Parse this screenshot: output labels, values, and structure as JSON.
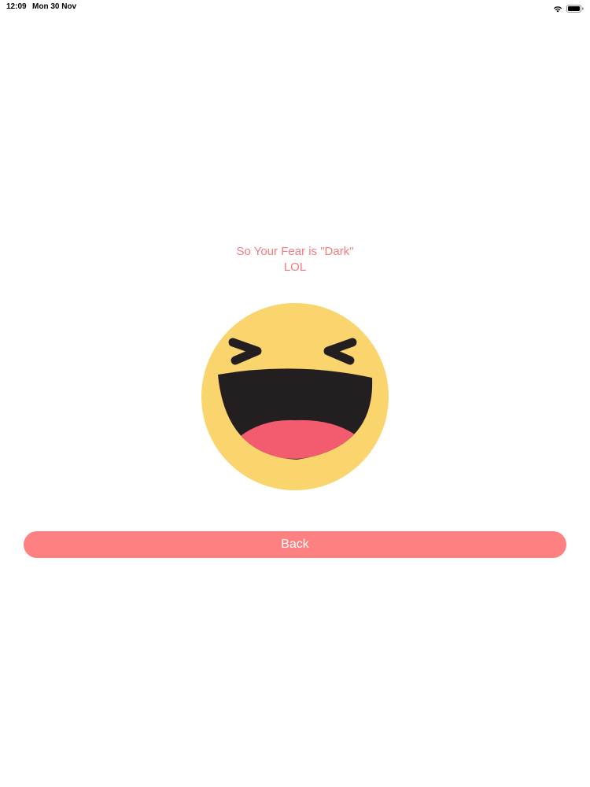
{
  "status_bar": {
    "time": "12:09",
    "date": "Mon 30 Nov",
    "icons": [
      "wifi-icon",
      "battery-icon"
    ]
  },
  "message": {
    "line1": "So Your Fear is \"Dark\"",
    "line2": "LOL"
  },
  "emoji": {
    "icon": "laughing-face-icon"
  },
  "back_button": {
    "label": "Back"
  },
  "colors": {
    "accent": "#FF8080",
    "message_text": "#F07C80",
    "emoji_face": "#FAD46C",
    "emoji_features": "#231F20",
    "emoji_tongue": "#F25C6E"
  }
}
